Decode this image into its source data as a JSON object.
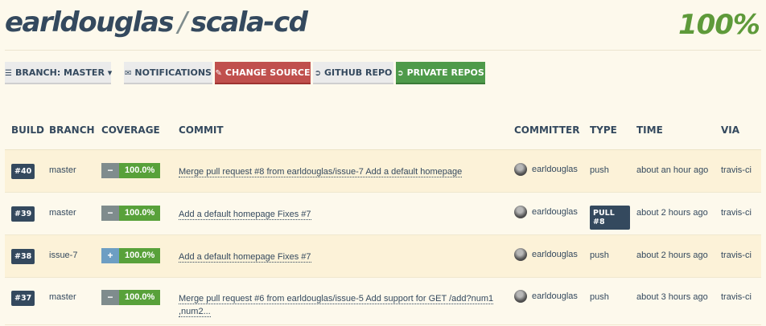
{
  "header": {
    "owner": "earldouglas",
    "separator": "/",
    "repo": "scala-cd",
    "coverage_total": "100%"
  },
  "toolbar": {
    "branch_label": "BRANCH: MASTER ▾",
    "notifications_label": "NOTIFICATIONS",
    "change_source_label": "CHANGE SOURCE",
    "github_repo_label": "GITHUB REPO",
    "private_repos_label": "PRIVATE REPOS"
  },
  "table": {
    "columns": [
      "BUILD",
      "BRANCH",
      "COVERAGE",
      "COMMIT",
      "COMMITTER",
      "TYPE",
      "TIME",
      "VIA"
    ],
    "rows": [
      {
        "build": "#40",
        "branch": "master",
        "trend": "same",
        "trend_icon": "−",
        "coverage": "100.0%",
        "commit": "Merge pull request #8 from earldouglas/issue-7 Add a default homepage",
        "committer": "earldouglas",
        "type": "push",
        "type_badge": false,
        "time": "about an hour ago",
        "via": "travis-ci"
      },
      {
        "build": "#39",
        "branch": "master",
        "trend": "same",
        "trend_icon": "−",
        "coverage": "100.0%",
        "commit": "Add a default homepage Fixes #7",
        "committer": "earldouglas",
        "type": "PULL #8",
        "type_badge": true,
        "time": "about 2 hours ago",
        "via": "travis-ci"
      },
      {
        "build": "#38",
        "branch": "issue-7",
        "trend": "up",
        "trend_icon": "+",
        "coverage": "100.0%",
        "commit": "Add a default homepage Fixes #7",
        "committer": "earldouglas",
        "type": "push",
        "type_badge": false,
        "time": "about 2 hours ago",
        "via": "travis-ci"
      },
      {
        "build": "#37",
        "branch": "master",
        "trend": "same",
        "trend_icon": "−",
        "coverage": "100.0%",
        "commit_line1": "Merge pull request #6 from earldouglas/issue-5 Add support for GET /add?num1",
        "commit_line2": ",num2...",
        "committer": "earldouglas",
        "type": "push",
        "type_badge": false,
        "time": "about 3 hours ago",
        "via": "travis-ci"
      }
    ]
  },
  "colors": {
    "background": "#fdf9ec",
    "text": "#34495e",
    "coverage_green": "#5e9a3a",
    "change_source_red": "#c0504d",
    "private_repos_green": "#4e9a4a"
  },
  "icons": {
    "branch": "list-icon",
    "notifications": "envelope-icon",
    "change_source": "edit-icon",
    "github_repo": "arrow-circle-icon",
    "private_repos": "arrow-circle-icon",
    "trend_same": "minus-icon",
    "trend_up": "plus-circle-icon"
  }
}
